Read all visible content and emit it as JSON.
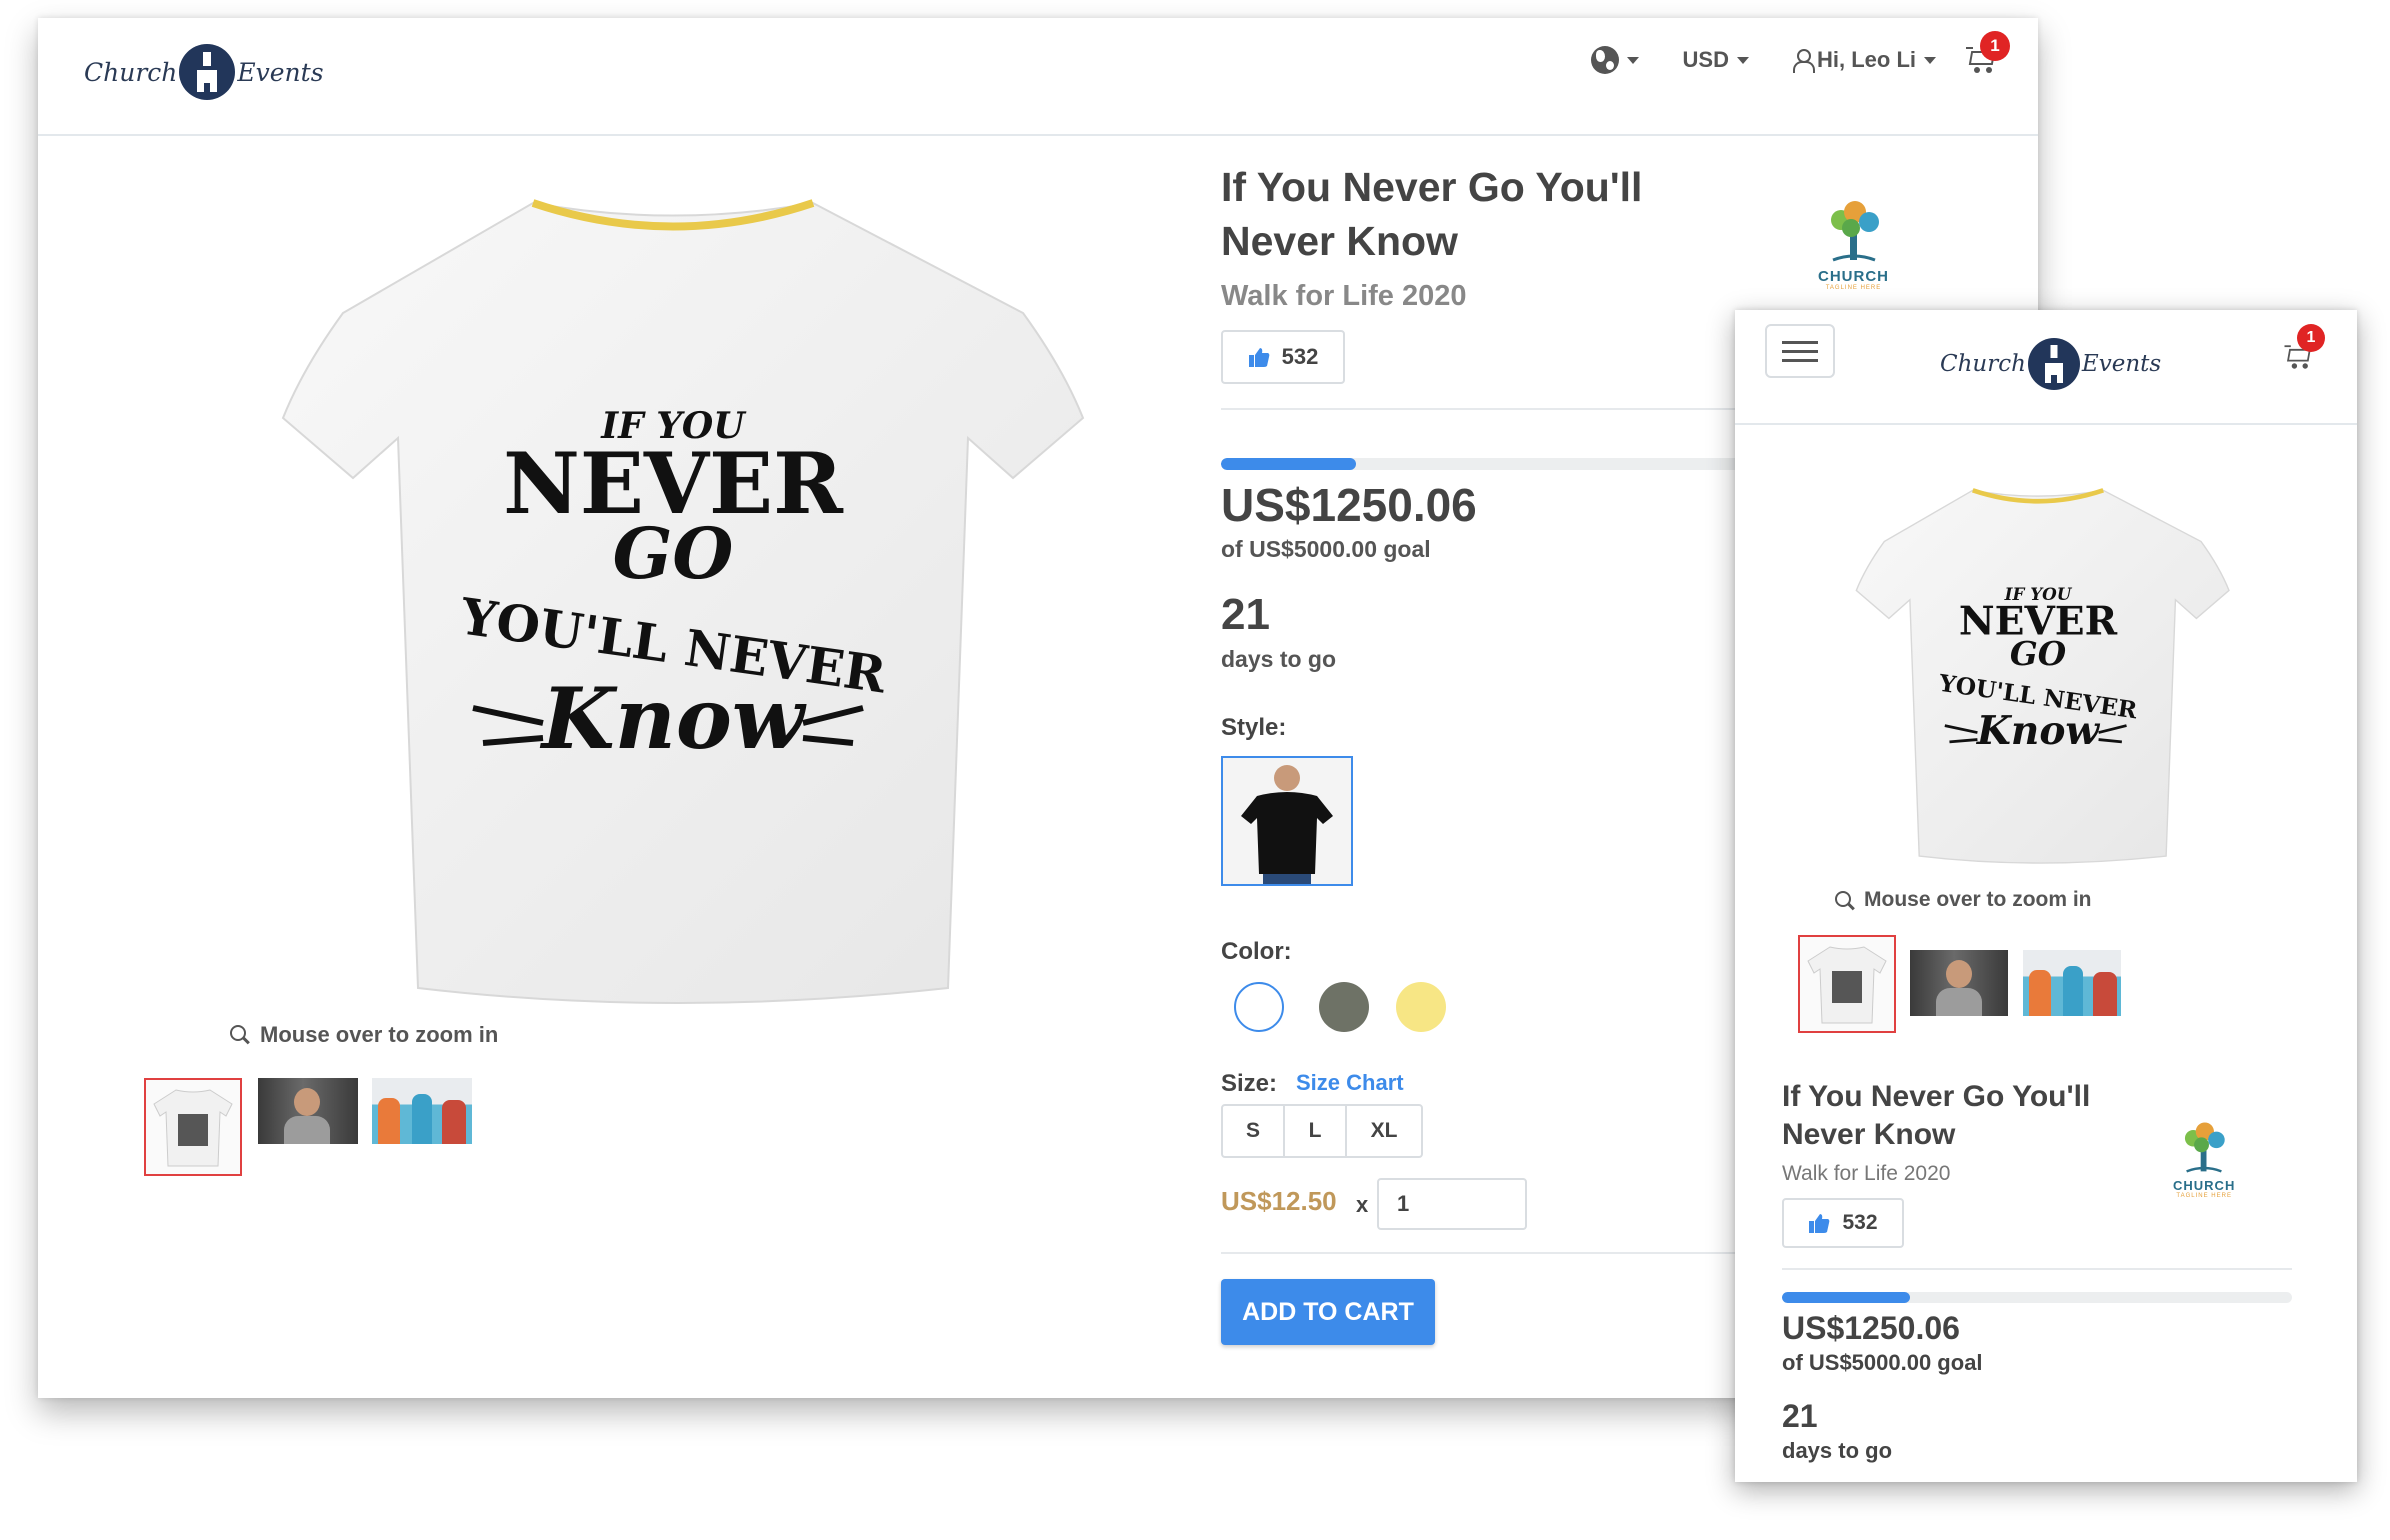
{
  "brand": {
    "logo_word_left": "Church",
    "logo_word_right": "Events"
  },
  "header": {
    "language_icon": "globe-icon",
    "currency": "USD",
    "user_greeting": "Hi, Leo Li",
    "cart_count": "1"
  },
  "product": {
    "title_line1": "If You Never Go You'll",
    "title_line2": "Never Know",
    "event": "Walk for Life 2020",
    "likes": "532",
    "zoom_hint": "Mouse over to zoom in",
    "print_text": {
      "top": "IF YOU",
      "line2": "NEVER",
      "line3": "GO",
      "line4": "YOU'LL NEVER",
      "line5": "Know"
    }
  },
  "campaign": {
    "raised": "US$1250.06",
    "goal": "of US$5000.00 goal",
    "progress_fraction": 0.25,
    "days": "21",
    "days_label": "days to go"
  },
  "options": {
    "style_label": "Style:",
    "color_label": "Color:",
    "colors": [
      "#ffffff",
      "#6e7266",
      "#f7e685"
    ],
    "size_label": "Size:",
    "size_chart": "Size Chart",
    "sizes": [
      "S",
      "L",
      "XL"
    ],
    "unit_price": "US$12.50",
    "times": "x",
    "quantity": "1",
    "add_to_cart": "ADD TO CART"
  },
  "org_logo": {
    "name": "CHURCH",
    "tagline": "TAGLINE HERE"
  },
  "colors": {
    "accent": "#3d8bea",
    "price": "#c0985a",
    "badge": "#e02424",
    "selected_thumb": "#e04040"
  }
}
